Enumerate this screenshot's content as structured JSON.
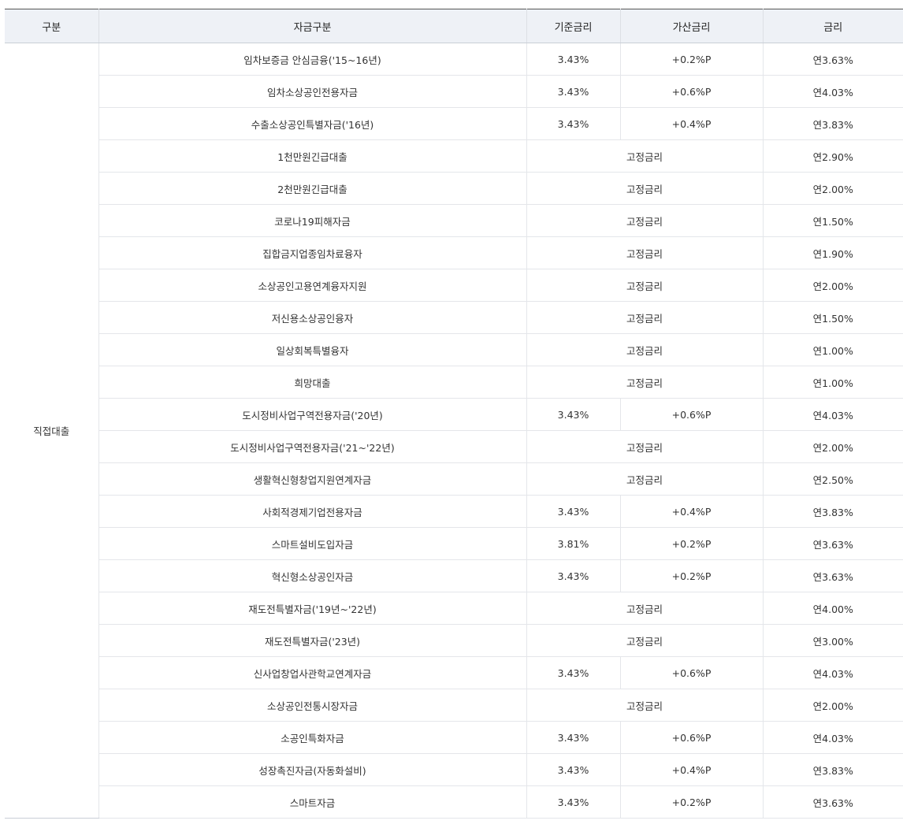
{
  "table": {
    "headers": [
      "구분",
      "자금구분",
      "기준금리",
      "가산금리",
      "금리"
    ],
    "category": "직접대출",
    "rows": [
      {
        "fund": "임차보증금 안심금융('15~16년)",
        "base": "3.43%",
        "add": "+0.2%P",
        "rate": "연3.63%"
      },
      {
        "fund": "임차소상공인전용자금",
        "base": "3.43%",
        "add": "+0.6%P",
        "rate": "연4.03%"
      },
      {
        "fund": "수출소상공인특별자금('16년)",
        "base": "3.43%",
        "add": "+0.4%P",
        "rate": "연3.83%"
      },
      {
        "fund": "1천만원긴급대출",
        "fixed": "고정금리",
        "rate": "연2.90%"
      },
      {
        "fund": "2천만원긴급대출",
        "fixed": "고정금리",
        "rate": "연2.00%"
      },
      {
        "fund": "코로나19피해자금",
        "fixed": "고정금리",
        "rate": "연1.50%"
      },
      {
        "fund": "집합금지업종임차료융자",
        "fixed": "고정금리",
        "rate": "연1.90%"
      },
      {
        "fund": "소상공인고용연계융자지원",
        "fixed": "고정금리",
        "rate": "연2.00%"
      },
      {
        "fund": "저신용소상공인융자",
        "fixed": "고정금리",
        "rate": "연1.50%"
      },
      {
        "fund": "일상회복특별융자",
        "fixed": "고정금리",
        "rate": "연1.00%"
      },
      {
        "fund": "희망대출",
        "fixed": "고정금리",
        "rate": "연1.00%"
      },
      {
        "fund": "도시정비사업구역전용자금('20년)",
        "base": "3.43%",
        "add": "+0.6%P",
        "rate": "연4.03%"
      },
      {
        "fund": "도시정비사업구역전용자금('21~'22년)",
        "fixed": "고정금리",
        "rate": "연2.00%"
      },
      {
        "fund": "생활혁신형창업지원연계자금",
        "fixed": "고정금리",
        "rate": "연2.50%"
      },
      {
        "fund": "사회적경제기업전용자금",
        "base": "3.43%",
        "add": "+0.4%P",
        "rate": "연3.83%"
      },
      {
        "fund": "스마트설비도입자금",
        "base": "3.81%",
        "add": "+0.2%P",
        "rate": "연3.63%"
      },
      {
        "fund": "혁신형소상공인자금",
        "base": "3.43%",
        "add": "+0.2%P",
        "rate": "연3.63%"
      },
      {
        "fund": "재도전특별자금('19년~'22년)",
        "fixed": "고정금리",
        "rate": "연4.00%"
      },
      {
        "fund": "재도전특별자금('23년)",
        "fixed": "고정금리",
        "rate": "연3.00%"
      },
      {
        "fund": "신사업창업사관학교연계자금",
        "base": "3.43%",
        "add": "+0.6%P",
        "rate": "연4.03%"
      },
      {
        "fund": "소상공인전통시장자금",
        "fixed": "고정금리",
        "rate": "연2.00%"
      },
      {
        "fund": "소공인특화자금",
        "base": "3.43%",
        "add": "+0.6%P",
        "rate": "연4.03%"
      },
      {
        "fund": "성장촉진자금(자동화설비)",
        "base": "3.43%",
        "add": "+0.4%P",
        "rate": "연3.83%"
      },
      {
        "fund": "스마트자금",
        "base": "3.43%",
        "add": "+0.2%P",
        "rate": "연3.63%"
      }
    ]
  }
}
